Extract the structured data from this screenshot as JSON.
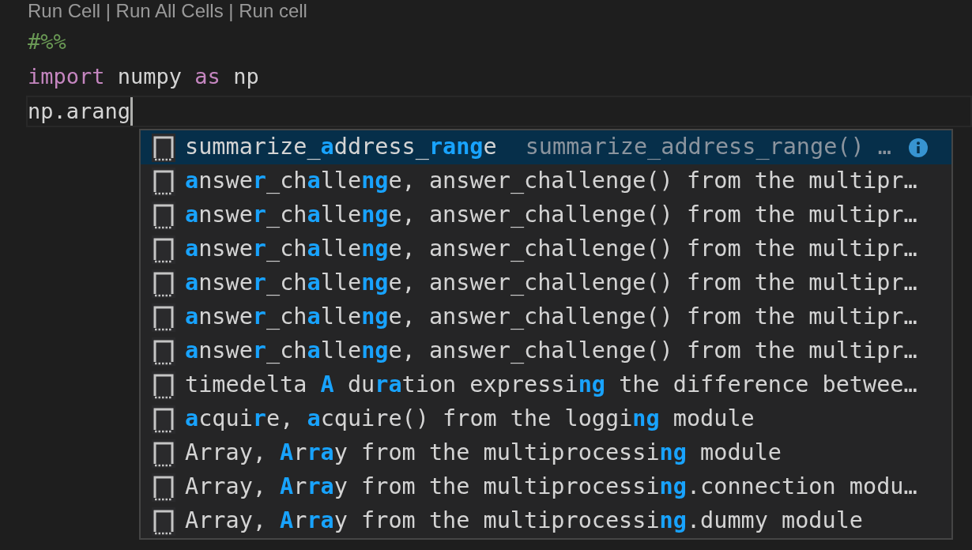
{
  "codelens": "Run Cell | Run All Cells | Run cell",
  "code_lines": [
    {
      "kind": "comment",
      "text": "#%%"
    },
    {
      "kind": "import",
      "keyword": "import",
      "module": "numpy",
      "alias_keyword": "as",
      "alias": "np"
    },
    {
      "kind": "current",
      "text": "np.arang"
    }
  ],
  "suggestions": [
    {
      "label": "summarize_**a**ddress_**rang**e",
      "detail": "summarize_address_range() …",
      "selected": true
    },
    {
      "label": "**a**nswe**r**_ch**a**lle**ng**e, answer_challenge() from the multipr…",
      "selected": false
    },
    {
      "label": "**a**nswe**r**_ch**a**lle**ng**e, answer_challenge() from the multipr…",
      "selected": false
    },
    {
      "label": "**a**nswe**r**_ch**a**lle**ng**e, answer_challenge() from the multipr…",
      "selected": false
    },
    {
      "label": "**a**nswe**r**_ch**a**lle**ng**e, answer_challenge() from the multipr…",
      "selected": false
    },
    {
      "label": "**a**nswe**r**_ch**a**lle**ng**e, answer_challenge() from the multipr…",
      "selected": false
    },
    {
      "label": "**a**nswe**r**_ch**a**lle**ng**e, answer_challenge() from the multipr…",
      "selected": false
    },
    {
      "label": "timedelta **A** du**ra**tion expressi**ng** the difference betwee…",
      "selected": false
    },
    {
      "label": "**a**cqui**r**e, **a**cquire() from the loggi**ng** module",
      "selected": false
    },
    {
      "label": "Array, **A**r**ra**y from the multiprocessi**ng** module",
      "selected": false
    },
    {
      "label": "Array, **A**r**ra**y from the multiprocessi**ng**.connection modu…",
      "selected": false
    },
    {
      "label": "Array, **A**r**ra**y from the multiprocessi**ng**.dummy module",
      "selected": false
    }
  ]
}
